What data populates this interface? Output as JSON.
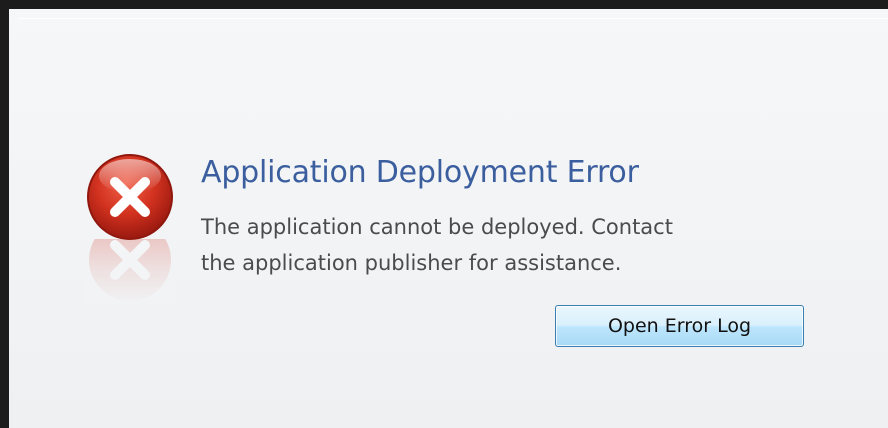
{
  "dialog": {
    "title": "Application Deployment Error",
    "message_line1": "The application cannot be deployed. Contact",
    "message_line2": "the application publisher for assistance.",
    "open_error_log_label": "Open Error Log",
    "icon": "error-icon"
  },
  "colors": {
    "title": "#3a5e9e",
    "message_text": "#4b4b4b",
    "icon_red": "#c4231b",
    "button_border": "#3c7fb1",
    "window_border": "#1c1c1c",
    "background": "#f1f3f5"
  }
}
